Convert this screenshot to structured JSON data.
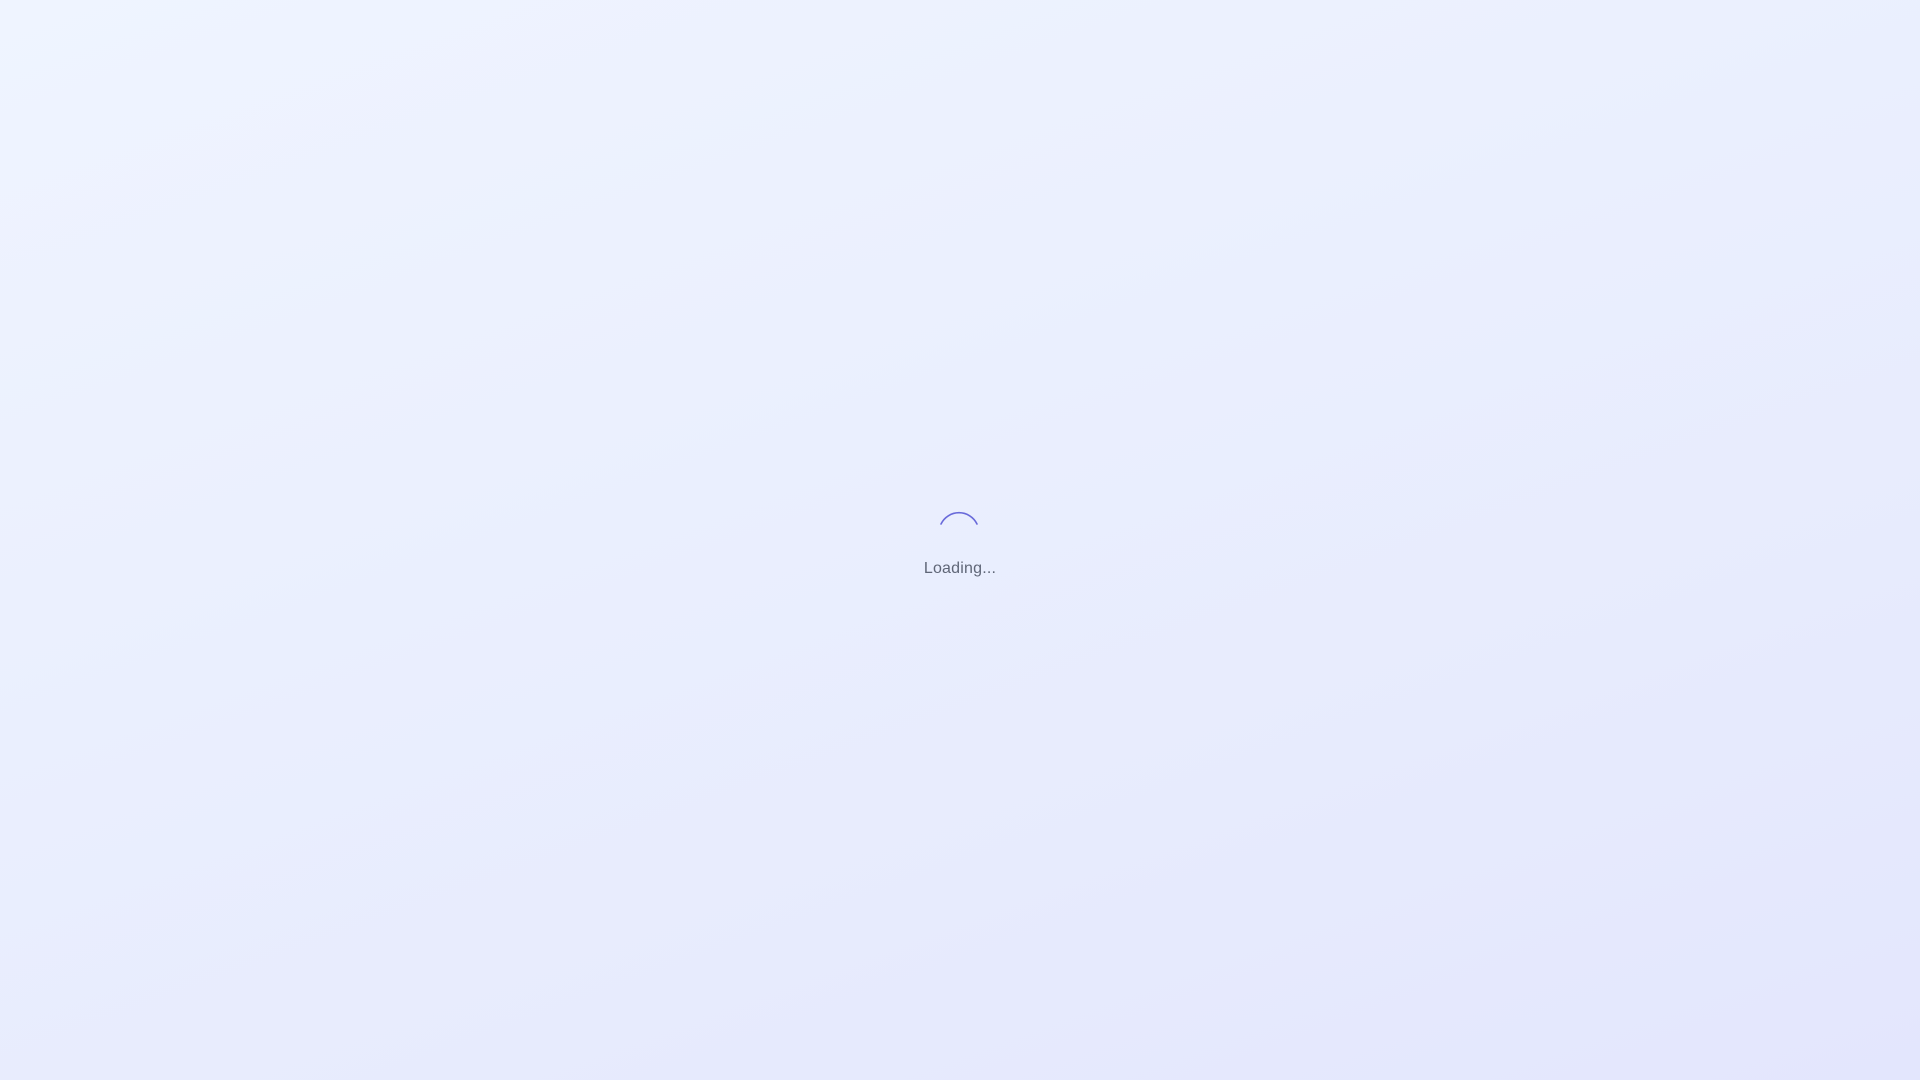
{
  "loader": {
    "text": "Loading...",
    "spinner_icon": "spinner-icon",
    "accent_color": "#5b5bd6",
    "text_color": "#5f6677"
  }
}
